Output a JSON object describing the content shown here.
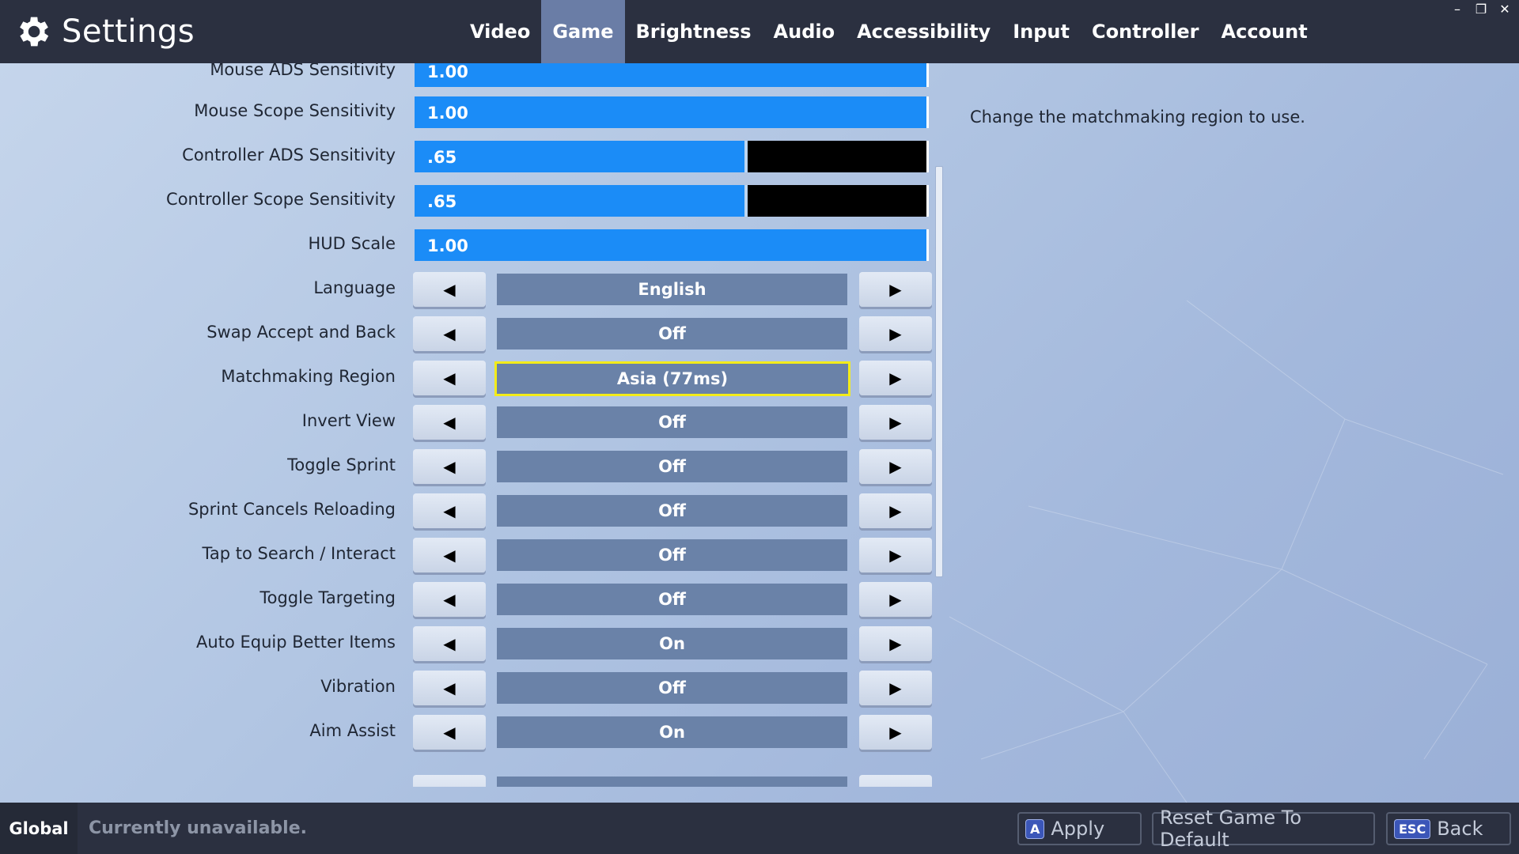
{
  "header": {
    "title": "Settings",
    "tabs": [
      {
        "label": "Video"
      },
      {
        "label": "Game",
        "active": true
      },
      {
        "label": "Brightness"
      },
      {
        "label": "Audio"
      },
      {
        "label": "Accessibility"
      },
      {
        "label": "Input"
      },
      {
        "label": "Controller"
      },
      {
        "label": "Account"
      }
    ]
  },
  "sliders": [
    {
      "label": "Mouse ADS Sensitivity",
      "value": "1.00",
      "fill_fraction": 1.0
    },
    {
      "label": "Mouse Scope Sensitivity",
      "value": "1.00",
      "fill_fraction": 1.0
    },
    {
      "label": "Controller ADS Sensitivity",
      "value": ".65",
      "fill_fraction": 0.65
    },
    {
      "label": "Controller Scope Sensitivity",
      "value": ".65",
      "fill_fraction": 0.65
    },
    {
      "label": "HUD Scale",
      "value": "1.00",
      "fill_fraction": 1.0
    }
  ],
  "options": [
    {
      "label": "Language",
      "value": "English"
    },
    {
      "label": "Swap Accept and Back",
      "value": "Off"
    },
    {
      "label": "Matchmaking Region",
      "value": "Asia (77ms)",
      "selected": true
    },
    {
      "label": "Invert View",
      "value": "Off"
    },
    {
      "label": "Toggle Sprint",
      "value": "Off"
    },
    {
      "label": "Sprint Cancels Reloading",
      "value": "Off"
    },
    {
      "label": "Tap to Search / Interact",
      "value": "Off"
    },
    {
      "label": "Toggle Targeting",
      "value": "Off"
    },
    {
      "label": "Auto Equip Better Items",
      "value": "On"
    },
    {
      "label": "Vibration",
      "value": "Off"
    },
    {
      "label": "Aim Assist",
      "value": "On"
    }
  ],
  "arrows": {
    "left": "◀",
    "right": "▶"
  },
  "description": "Change the matchmaking region to use.",
  "footer": {
    "scope": "Global",
    "status": "Currently unavailable.",
    "apply": {
      "key": "A",
      "label": "Apply"
    },
    "reset": {
      "label": "Reset Game To Default"
    },
    "back": {
      "key": "ESC",
      "label": "Back"
    }
  },
  "window_controls": {
    "minimize": "–",
    "restore": "❐",
    "close": "✕"
  },
  "colors": {
    "slider_fill": "#1b8cf7",
    "selected_border": "#f3ec1a",
    "topbar": "#2b3040"
  }
}
